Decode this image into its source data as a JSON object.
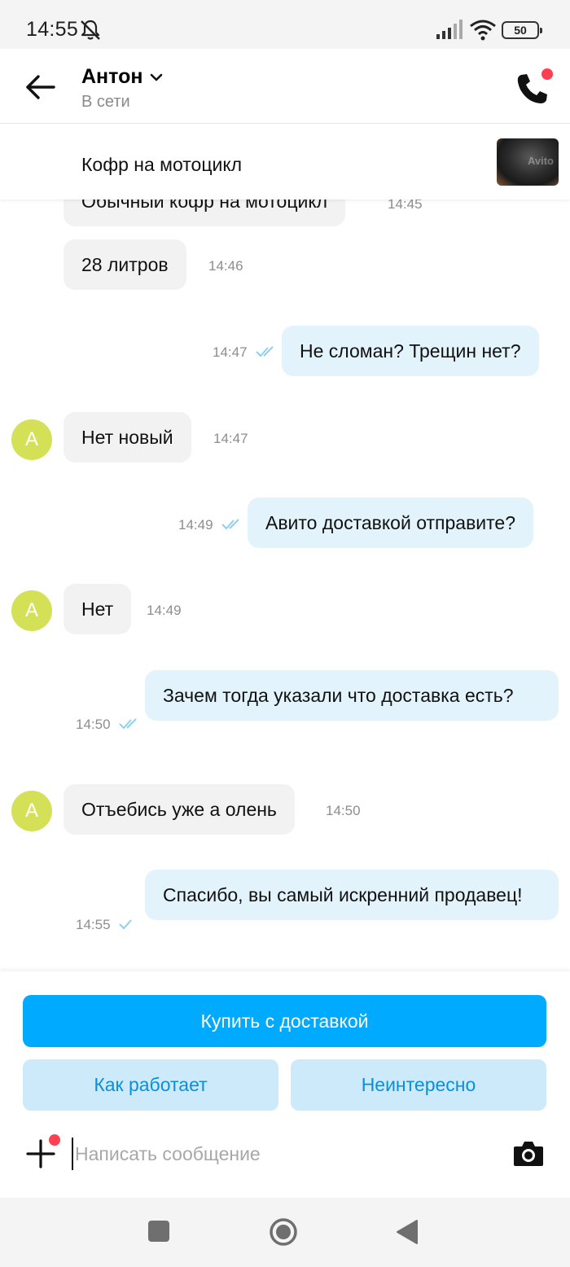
{
  "status_bar": {
    "time": "14:55",
    "battery": "50",
    "icons": [
      "bell-muted-icon",
      "signal-icon",
      "wifi-icon",
      "battery-icon"
    ]
  },
  "header": {
    "contact_name": "Антон",
    "contact_status": "В сети",
    "icons": [
      "back-arrow-icon",
      "chevron-down-icon",
      "phone-icon"
    ]
  },
  "listing": {
    "title": "Кофр на мотоцикл"
  },
  "messages": [
    {
      "dir": "in",
      "text": "Обычный кофр на мотоцикл",
      "time": "14:45"
    },
    {
      "dir": "in",
      "text": "28 литров",
      "time": "14:46"
    },
    {
      "dir": "out",
      "text": "Не сломан? Трещин нет?",
      "time": "14:47",
      "status": "read"
    },
    {
      "dir": "in",
      "text": "Нет новый",
      "time": "14:47",
      "avatar": "А"
    },
    {
      "dir": "out",
      "text": "Авито доставкой отправите?",
      "time": "14:49",
      "status": "read"
    },
    {
      "dir": "in",
      "text": "Нет",
      "time": "14:49",
      "avatar": "А"
    },
    {
      "dir": "out",
      "text": "Зачем тогда указали что доставка есть?",
      "time": "14:50",
      "status": "read"
    },
    {
      "dir": "in",
      "text": "Отъебись уже а олень",
      "time": "14:50",
      "avatar": "А"
    },
    {
      "dir": "out",
      "text": "Спасибо, вы самый искренний продавец!",
      "time": "14:55",
      "status": "sent"
    }
  ],
  "actions": {
    "buy_label": "Купить с доставкой",
    "how_label": "Как работает",
    "not_interested_label": "Неинтересно"
  },
  "composer": {
    "placeholder": "Написать сообщение",
    "value": ""
  },
  "colors": {
    "primary": "#00aaff",
    "secondary_bg": "#cdeafb",
    "secondary_text": "#0a8fdb",
    "incoming_bubble": "#f2f2f2",
    "outgoing_bubble": "#e3f3fc",
    "avatar": "#d4e157",
    "notification_dot": "#ff4053",
    "read_check": "#8fd0f0"
  }
}
